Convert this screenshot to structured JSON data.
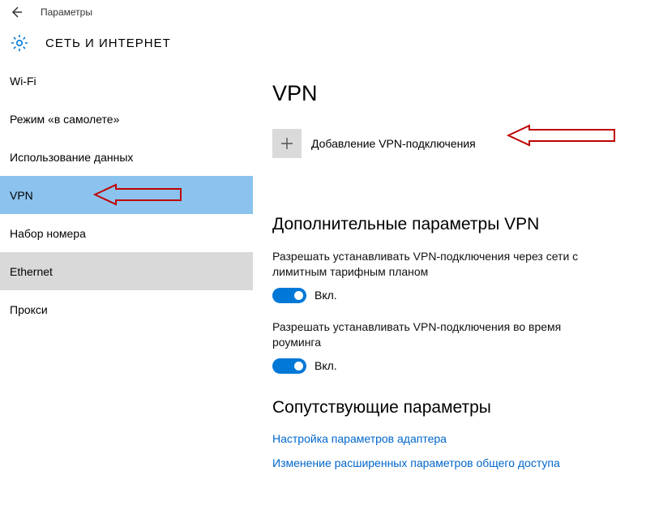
{
  "titlebar": {
    "title": "Параметры"
  },
  "header": {
    "title": "СЕТЬ И ИНТЕРНЕТ"
  },
  "sidebar": {
    "items": [
      {
        "label": "Wi-Fi"
      },
      {
        "label": "Режим «в самолете»"
      },
      {
        "label": "Использование данных"
      },
      {
        "label": "VPN"
      },
      {
        "label": "Набор номера"
      },
      {
        "label": "Ethernet"
      },
      {
        "label": "Прокси"
      }
    ]
  },
  "content": {
    "heading": "VPN",
    "add_label": "Добавление VPN-подключения",
    "advanced_heading": "Дополнительные параметры VPN",
    "option1_desc": "Разрешать устанавливать VPN-подключения через сети с лимитным тарифным планом",
    "option1_state": "Вкл.",
    "option2_desc": "Разрешать устанавливать VPN-подключения во время роуминга",
    "option2_state": "Вкл.",
    "related_heading": "Сопутствующие параметры",
    "link1": "Настройка параметров адаптера",
    "link2": "Изменение расширенных параметров общего доступа"
  }
}
